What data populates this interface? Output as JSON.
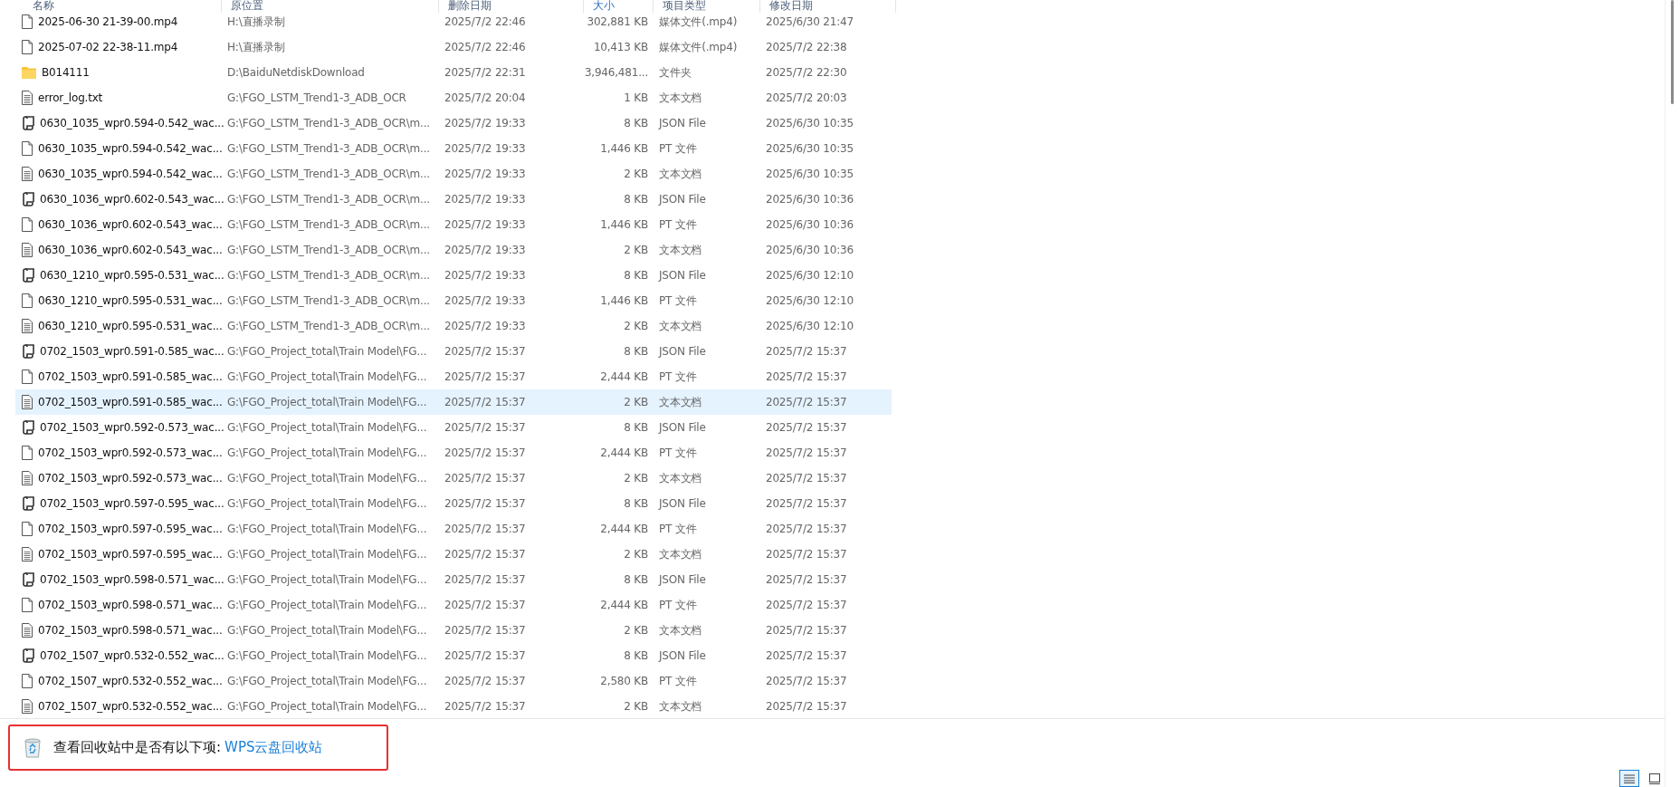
{
  "columns": [
    {
      "label": "名称",
      "sorted": false
    },
    {
      "label": "原位置",
      "sorted": false
    },
    {
      "label": "删除日期",
      "sorted": false
    },
    {
      "label": "大小",
      "sorted": true
    },
    {
      "label": "项目类型",
      "sorted": false
    },
    {
      "label": "修改日期",
      "sorted": false
    }
  ],
  "rows": [
    {
      "kind": "video",
      "name": "2025-06-30 21-39-00.mp4",
      "location": "H:\\直播录制",
      "deleted": "2025/7/2 22:46",
      "size": "302,881 KB",
      "type": "媒体文件(.mp4)",
      "modified": "2025/6/30 21:47",
      "selected": false
    },
    {
      "kind": "video",
      "name": "2025-07-02 22-38-11.mp4",
      "location": "H:\\直播录制",
      "deleted": "2025/7/2 22:46",
      "size": "10,413 KB",
      "type": "媒体文件(.mp4)",
      "modified": "2025/7/2 22:38",
      "selected": false
    },
    {
      "kind": "folder",
      "name": "B014111",
      "location": "D:\\BaiduNetdiskDownload",
      "deleted": "2025/7/2 22:31",
      "size": "3,946,481...",
      "type": "文件夹",
      "modified": "2025/7/2 22:30",
      "selected": false
    },
    {
      "kind": "text",
      "name": "error_log.txt",
      "location": "G:\\FGO_LSTM_Trend1-3_ADB_OCR",
      "deleted": "2025/7/2 20:04",
      "size": "1 KB",
      "type": "文本文档",
      "modified": "2025/7/2 20:03",
      "selected": false
    },
    {
      "kind": "json",
      "name": "0630_1035_wpr0.594-0.542_wac...",
      "location": "G:\\FGO_LSTM_Trend1-3_ADB_OCR\\m...",
      "deleted": "2025/7/2 19:33",
      "size": "8 KB",
      "type": "JSON File",
      "modified": "2025/6/30 10:35",
      "selected": false
    },
    {
      "kind": "blank",
      "name": "0630_1035_wpr0.594-0.542_wac...",
      "location": "G:\\FGO_LSTM_Trend1-3_ADB_OCR\\m...",
      "deleted": "2025/7/2 19:33",
      "size": "1,446 KB",
      "type": "PT 文件",
      "modified": "2025/6/30 10:35",
      "selected": false
    },
    {
      "kind": "text",
      "name": "0630_1035_wpr0.594-0.542_wac...",
      "location": "G:\\FGO_LSTM_Trend1-3_ADB_OCR\\m...",
      "deleted": "2025/7/2 19:33",
      "size": "2 KB",
      "type": "文本文档",
      "modified": "2025/6/30 10:35",
      "selected": false
    },
    {
      "kind": "json",
      "name": "0630_1036_wpr0.602-0.543_wac...",
      "location": "G:\\FGO_LSTM_Trend1-3_ADB_OCR\\m...",
      "deleted": "2025/7/2 19:33",
      "size": "8 KB",
      "type": "JSON File",
      "modified": "2025/6/30 10:36",
      "selected": false
    },
    {
      "kind": "blank",
      "name": "0630_1036_wpr0.602-0.543_wac...",
      "location": "G:\\FGO_LSTM_Trend1-3_ADB_OCR\\m...",
      "deleted": "2025/7/2 19:33",
      "size": "1,446 KB",
      "type": "PT 文件",
      "modified": "2025/6/30 10:36",
      "selected": false
    },
    {
      "kind": "text",
      "name": "0630_1036_wpr0.602-0.543_wac...",
      "location": "G:\\FGO_LSTM_Trend1-3_ADB_OCR\\m...",
      "deleted": "2025/7/2 19:33",
      "size": "2 KB",
      "type": "文本文档",
      "modified": "2025/6/30 10:36",
      "selected": false
    },
    {
      "kind": "json",
      "name": "0630_1210_wpr0.595-0.531_wac...",
      "location": "G:\\FGO_LSTM_Trend1-3_ADB_OCR\\m...",
      "deleted": "2025/7/2 19:33",
      "size": "8 KB",
      "type": "JSON File",
      "modified": "2025/6/30 12:10",
      "selected": false
    },
    {
      "kind": "blank",
      "name": "0630_1210_wpr0.595-0.531_wac...",
      "location": "G:\\FGO_LSTM_Trend1-3_ADB_OCR\\m...",
      "deleted": "2025/7/2 19:33",
      "size": "1,446 KB",
      "type": "PT 文件",
      "modified": "2025/6/30 12:10",
      "selected": false
    },
    {
      "kind": "text",
      "name": "0630_1210_wpr0.595-0.531_wac...",
      "location": "G:\\FGO_LSTM_Trend1-3_ADB_OCR\\m...",
      "deleted": "2025/7/2 19:33",
      "size": "2 KB",
      "type": "文本文档",
      "modified": "2025/6/30 12:10",
      "selected": false
    },
    {
      "kind": "json",
      "name": "0702_1503_wpr0.591-0.585_wac...",
      "location": "G:\\FGO_Project_total\\Train Model\\FG...",
      "deleted": "2025/7/2 15:37",
      "size": "8 KB",
      "type": "JSON File",
      "modified": "2025/7/2 15:37",
      "selected": false
    },
    {
      "kind": "blank",
      "name": "0702_1503_wpr0.591-0.585_wac...",
      "location": "G:\\FGO_Project_total\\Train Model\\FG...",
      "deleted": "2025/7/2 15:37",
      "size": "2,444 KB",
      "type": "PT 文件",
      "modified": "2025/7/2 15:37",
      "selected": false
    },
    {
      "kind": "text",
      "name": "0702_1503_wpr0.591-0.585_wac...",
      "location": "G:\\FGO_Project_total\\Train Model\\FG...",
      "deleted": "2025/7/2 15:37",
      "size": "2 KB",
      "type": "文本文档",
      "modified": "2025/7/2 15:37",
      "selected": true
    },
    {
      "kind": "json",
      "name": "0702_1503_wpr0.592-0.573_wac...",
      "location": "G:\\FGO_Project_total\\Train Model\\FG...",
      "deleted": "2025/7/2 15:37",
      "size": "8 KB",
      "type": "JSON File",
      "modified": "2025/7/2 15:37",
      "selected": false
    },
    {
      "kind": "blank",
      "name": "0702_1503_wpr0.592-0.573_wac...",
      "location": "G:\\FGO_Project_total\\Train Model\\FG...",
      "deleted": "2025/7/2 15:37",
      "size": "2,444 KB",
      "type": "PT 文件",
      "modified": "2025/7/2 15:37",
      "selected": false
    },
    {
      "kind": "text",
      "name": "0702_1503_wpr0.592-0.573_wac...",
      "location": "G:\\FGO_Project_total\\Train Model\\FG...",
      "deleted": "2025/7/2 15:37",
      "size": "2 KB",
      "type": "文本文档",
      "modified": "2025/7/2 15:37",
      "selected": false
    },
    {
      "kind": "json",
      "name": "0702_1503_wpr0.597-0.595_wac...",
      "location": "G:\\FGO_Project_total\\Train Model\\FG...",
      "deleted": "2025/7/2 15:37",
      "size": "8 KB",
      "type": "JSON File",
      "modified": "2025/7/2 15:37",
      "selected": false
    },
    {
      "kind": "blank",
      "name": "0702_1503_wpr0.597-0.595_wac...",
      "location": "G:\\FGO_Project_total\\Train Model\\FG...",
      "deleted": "2025/7/2 15:37",
      "size": "2,444 KB",
      "type": "PT 文件",
      "modified": "2025/7/2 15:37",
      "selected": false
    },
    {
      "kind": "text",
      "name": "0702_1503_wpr0.597-0.595_wac...",
      "location": "G:\\FGO_Project_total\\Train Model\\FG...",
      "deleted": "2025/7/2 15:37",
      "size": "2 KB",
      "type": "文本文档",
      "modified": "2025/7/2 15:37",
      "selected": false
    },
    {
      "kind": "json",
      "name": "0702_1503_wpr0.598-0.571_wac...",
      "location": "G:\\FGO_Project_total\\Train Model\\FG...",
      "deleted": "2025/7/2 15:37",
      "size": "8 KB",
      "type": "JSON File",
      "modified": "2025/7/2 15:37",
      "selected": false
    },
    {
      "kind": "blank",
      "name": "0702_1503_wpr0.598-0.571_wac...",
      "location": "G:\\FGO_Project_total\\Train Model\\FG...",
      "deleted": "2025/7/2 15:37",
      "size": "2,444 KB",
      "type": "PT 文件",
      "modified": "2025/7/2 15:37",
      "selected": false
    },
    {
      "kind": "text",
      "name": "0702_1503_wpr0.598-0.571_wac...",
      "location": "G:\\FGO_Project_total\\Train Model\\FG...",
      "deleted": "2025/7/2 15:37",
      "size": "2 KB",
      "type": "文本文档",
      "modified": "2025/7/2 15:37",
      "selected": false
    },
    {
      "kind": "json",
      "name": "0702_1507_wpr0.532-0.552_wac...",
      "location": "G:\\FGO_Project_total\\Train Model\\FG...",
      "deleted": "2025/7/2 15:37",
      "size": "8 KB",
      "type": "JSON File",
      "modified": "2025/7/2 15:37",
      "selected": false
    },
    {
      "kind": "blank",
      "name": "0702_1507_wpr0.532-0.552_wac...",
      "location": "G:\\FGO_Project_total\\Train Model\\FG...",
      "deleted": "2025/7/2 15:37",
      "size": "2,580 KB",
      "type": "PT 文件",
      "modified": "2025/7/2 15:37",
      "selected": false
    },
    {
      "kind": "text",
      "name": "0702_1507_wpr0.532-0.552_wac...",
      "location": "G:\\FGO_Project_total\\Train Model\\FG...",
      "deleted": "2025/7/2 15:37",
      "size": "2 KB",
      "type": "文本文档",
      "modified": "2025/7/2 15:37",
      "selected": false
    }
  ],
  "footer": {
    "prompt": "查看回收站中是否有以下项:",
    "link": "WPS云盘回收站"
  },
  "view_buttons": [
    {
      "kind": "details",
      "selected": true
    },
    {
      "kind": "tiles",
      "selected": false
    }
  ]
}
